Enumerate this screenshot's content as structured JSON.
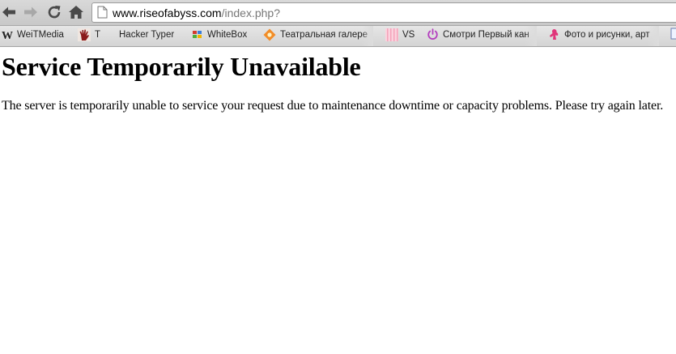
{
  "browser": {
    "url_host": "www.riseofabyss.com",
    "url_path": "/index.php?"
  },
  "bookmarks": [
    {
      "label": "WeiTMedia",
      "icon": "w-letter-icon"
    },
    {
      "label": "T",
      "icon": "handprint-icon"
    },
    {
      "label": "Hacker Typer",
      "icon": ""
    },
    {
      "label": "WhiteBox",
      "icon": "colored-squares-icon"
    },
    {
      "label": "Театральная галере",
      "icon": "orange-diamond-icon"
    },
    {
      "label": "VS",
      "icon": "pink-stripes-icon"
    },
    {
      "label": "Смотри Первый кан",
      "icon": "power-icon"
    },
    {
      "label": "Фото и рисунки, арт",
      "icon": "pink-figure-icon"
    }
  ],
  "page": {
    "title": "Service Temporarily Unavailable",
    "message": "The server is temporarily unable to service your request due to maintenance downtime or capacity problems. Please try again later."
  }
}
